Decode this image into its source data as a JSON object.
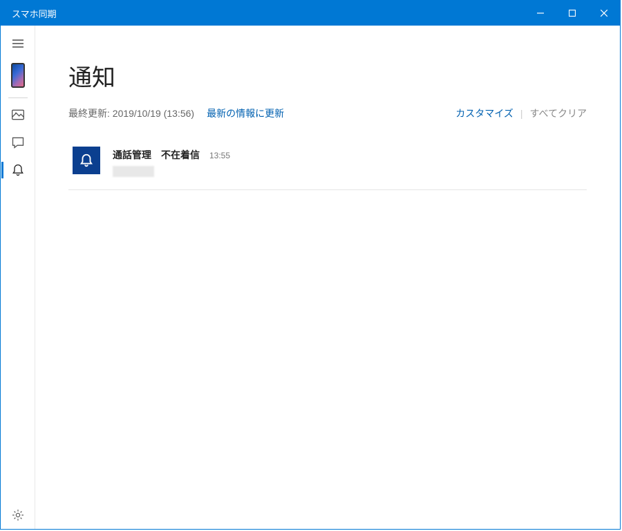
{
  "window": {
    "title": "スマホ同期"
  },
  "sidebar": {
    "items": [
      {
        "name": "hamburger"
      },
      {
        "name": "phone-thumb"
      },
      {
        "name": "photos"
      },
      {
        "name": "messages"
      },
      {
        "name": "notifications"
      }
    ],
    "settings": "設定"
  },
  "page": {
    "title": "通知",
    "last_updated": "最終更新: 2019/10/19 (13:56)",
    "refresh": "最新の情報に更新",
    "customize": "カスタマイズ",
    "clear_all": "すべてクリア"
  },
  "notifications": [
    {
      "app": "通話管理",
      "title": "不在着信",
      "time": "13:55",
      "detail": ""
    }
  ]
}
